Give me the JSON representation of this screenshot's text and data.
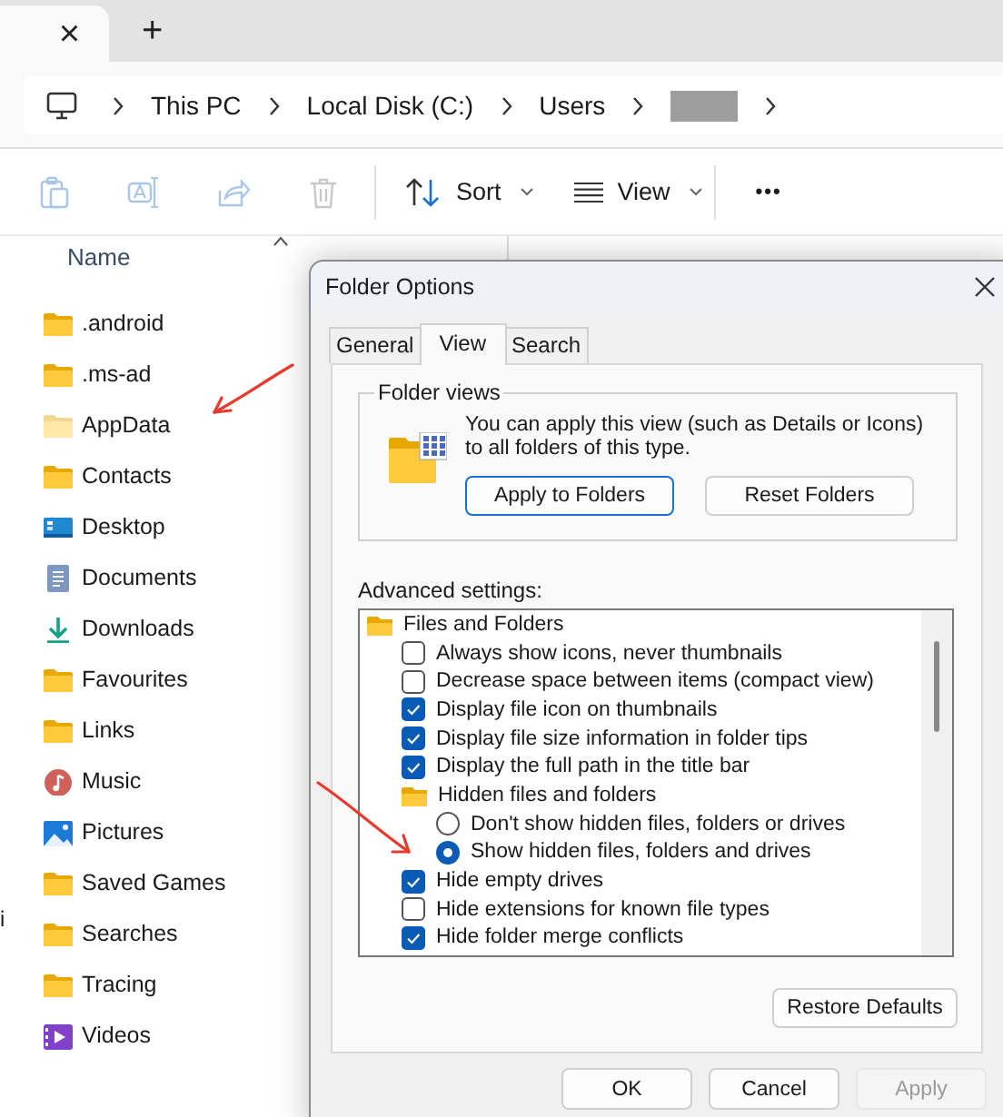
{
  "tab_strip": {
    "close_label": "×",
    "new_tab_label": "+"
  },
  "breadcrumb": [
    {
      "label": "This PC",
      "redacted": false
    },
    {
      "label": "Local Disk (C:)",
      "redacted": false
    },
    {
      "label": "Users",
      "redacted": false
    },
    {
      "redacted": true
    }
  ],
  "toolbar": {
    "sort_label": "Sort",
    "view_label": "View",
    "more_label": "•••"
  },
  "columns": [
    {
      "label": "Name"
    }
  ],
  "nav_pane_text": "i",
  "files": [
    {
      "name": ".android",
      "kind": "folder"
    },
    {
      "name": ".ms-ad",
      "kind": "folder"
    },
    {
      "name": "AppData",
      "kind": "hidden-folder"
    },
    {
      "name": "Contacts",
      "kind": "folder"
    },
    {
      "name": "Desktop",
      "kind": "desktop"
    },
    {
      "name": "Documents",
      "kind": "documents"
    },
    {
      "name": "Downloads",
      "kind": "downloads"
    },
    {
      "name": "Favourites",
      "kind": "folder"
    },
    {
      "name": "Links",
      "kind": "folder"
    },
    {
      "name": "Music",
      "kind": "music"
    },
    {
      "name": "Pictures",
      "kind": "pictures"
    },
    {
      "name": "Saved Games",
      "kind": "folder"
    },
    {
      "name": "Searches",
      "kind": "folder"
    },
    {
      "name": "Tracing",
      "kind": "folder"
    },
    {
      "name": "Videos",
      "kind": "videos"
    }
  ],
  "dialog": {
    "title": "Folder Options",
    "tabs": [
      {
        "label": "General",
        "selected": false
      },
      {
        "label": "View",
        "selected": true
      },
      {
        "label": "Search",
        "selected": false
      }
    ],
    "folder_views": {
      "legend": "Folder views",
      "text": "You can apply this view (such as Details or Icons) to all folders of this type.",
      "buttons": [
        {
          "label": "Apply to Folders",
          "default": true
        },
        {
          "label": "Reset Folders",
          "default": false
        }
      ]
    },
    "advanced_label": "Advanced settings:",
    "settings": [
      {
        "kind": "group",
        "label": "Files and Folders",
        "children": [
          {
            "kind": "checkbox",
            "label": "Always show icons, never thumbnails",
            "checked": false
          },
          {
            "kind": "checkbox",
            "label": "Decrease space between items (compact view)",
            "checked": false
          },
          {
            "kind": "checkbox",
            "label": "Display file icon on thumbnails",
            "checked": true
          },
          {
            "kind": "checkbox",
            "label": "Display file size information in folder tips",
            "checked": true
          },
          {
            "kind": "checkbox",
            "label": "Display the full path in the title bar",
            "checked": true
          },
          {
            "kind": "group",
            "label": "Hidden files and folders",
            "children": [
              {
                "kind": "radio",
                "label": "Don't show hidden files, folders or drives",
                "selected": false
              },
              {
                "kind": "radio",
                "label": "Show hidden files, folders and drives",
                "selected": true
              }
            ]
          },
          {
            "kind": "checkbox",
            "label": "Hide empty drives",
            "checked": true
          },
          {
            "kind": "checkbox",
            "label": "Hide extensions for known file types",
            "checked": false
          },
          {
            "kind": "checkbox",
            "label": "Hide folder merge conflicts",
            "checked": true
          }
        ]
      }
    ],
    "restore_label": "Restore Defaults",
    "buttons": [
      {
        "label": "OK",
        "disabled": false
      },
      {
        "label": "Cancel",
        "disabled": false
      },
      {
        "label": "Apply",
        "disabled": true
      }
    ]
  }
}
